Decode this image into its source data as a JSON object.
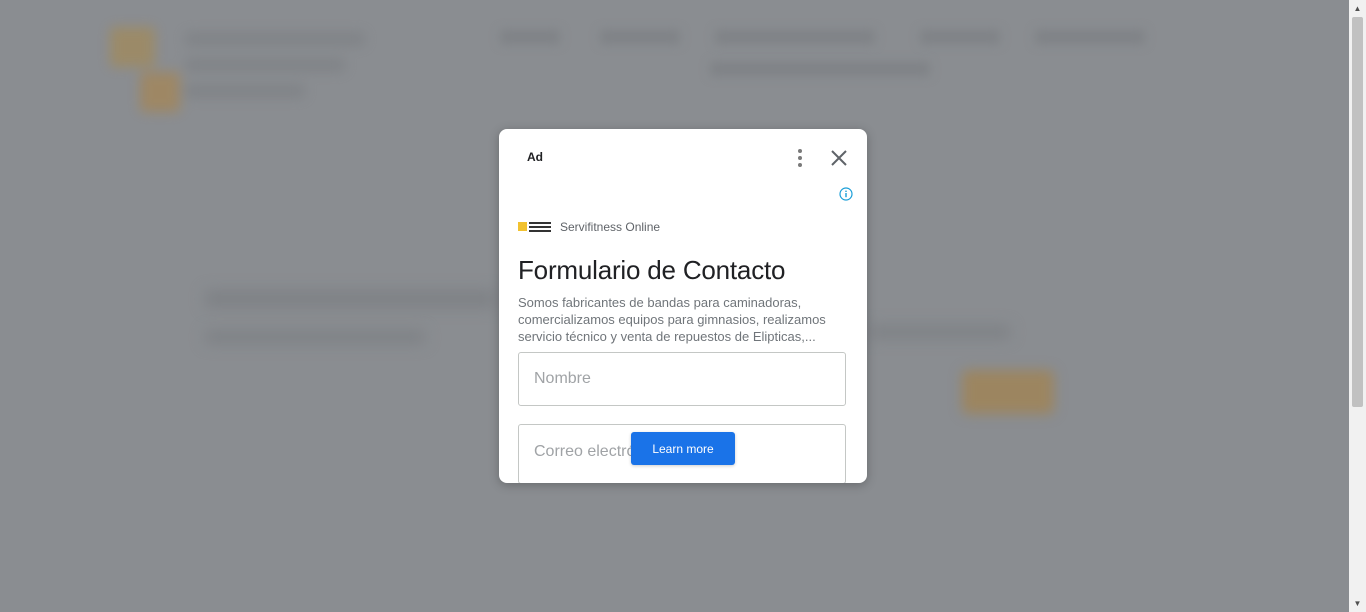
{
  "ad": {
    "label": "Ad",
    "advertiser": "Servifitness Online",
    "headline": "Formulario de Contacto",
    "description": "Somos fabricantes de bandas para caminadoras, comercializamos equipos para gimnasios, realizamos servicio técnico y venta de repuestos de Elipticas,...",
    "fields": {
      "name_placeholder": "Nombre",
      "email_placeholder": "Correo electrónico"
    },
    "cta_label": "Learn more",
    "icons": {
      "more": "more-vert-icon",
      "close": "close-icon",
      "info": "info-icon"
    },
    "colors": {
      "cta": "#1a73e8",
      "info": "#1a9ed8",
      "logo_accent": "#f2c230"
    }
  }
}
